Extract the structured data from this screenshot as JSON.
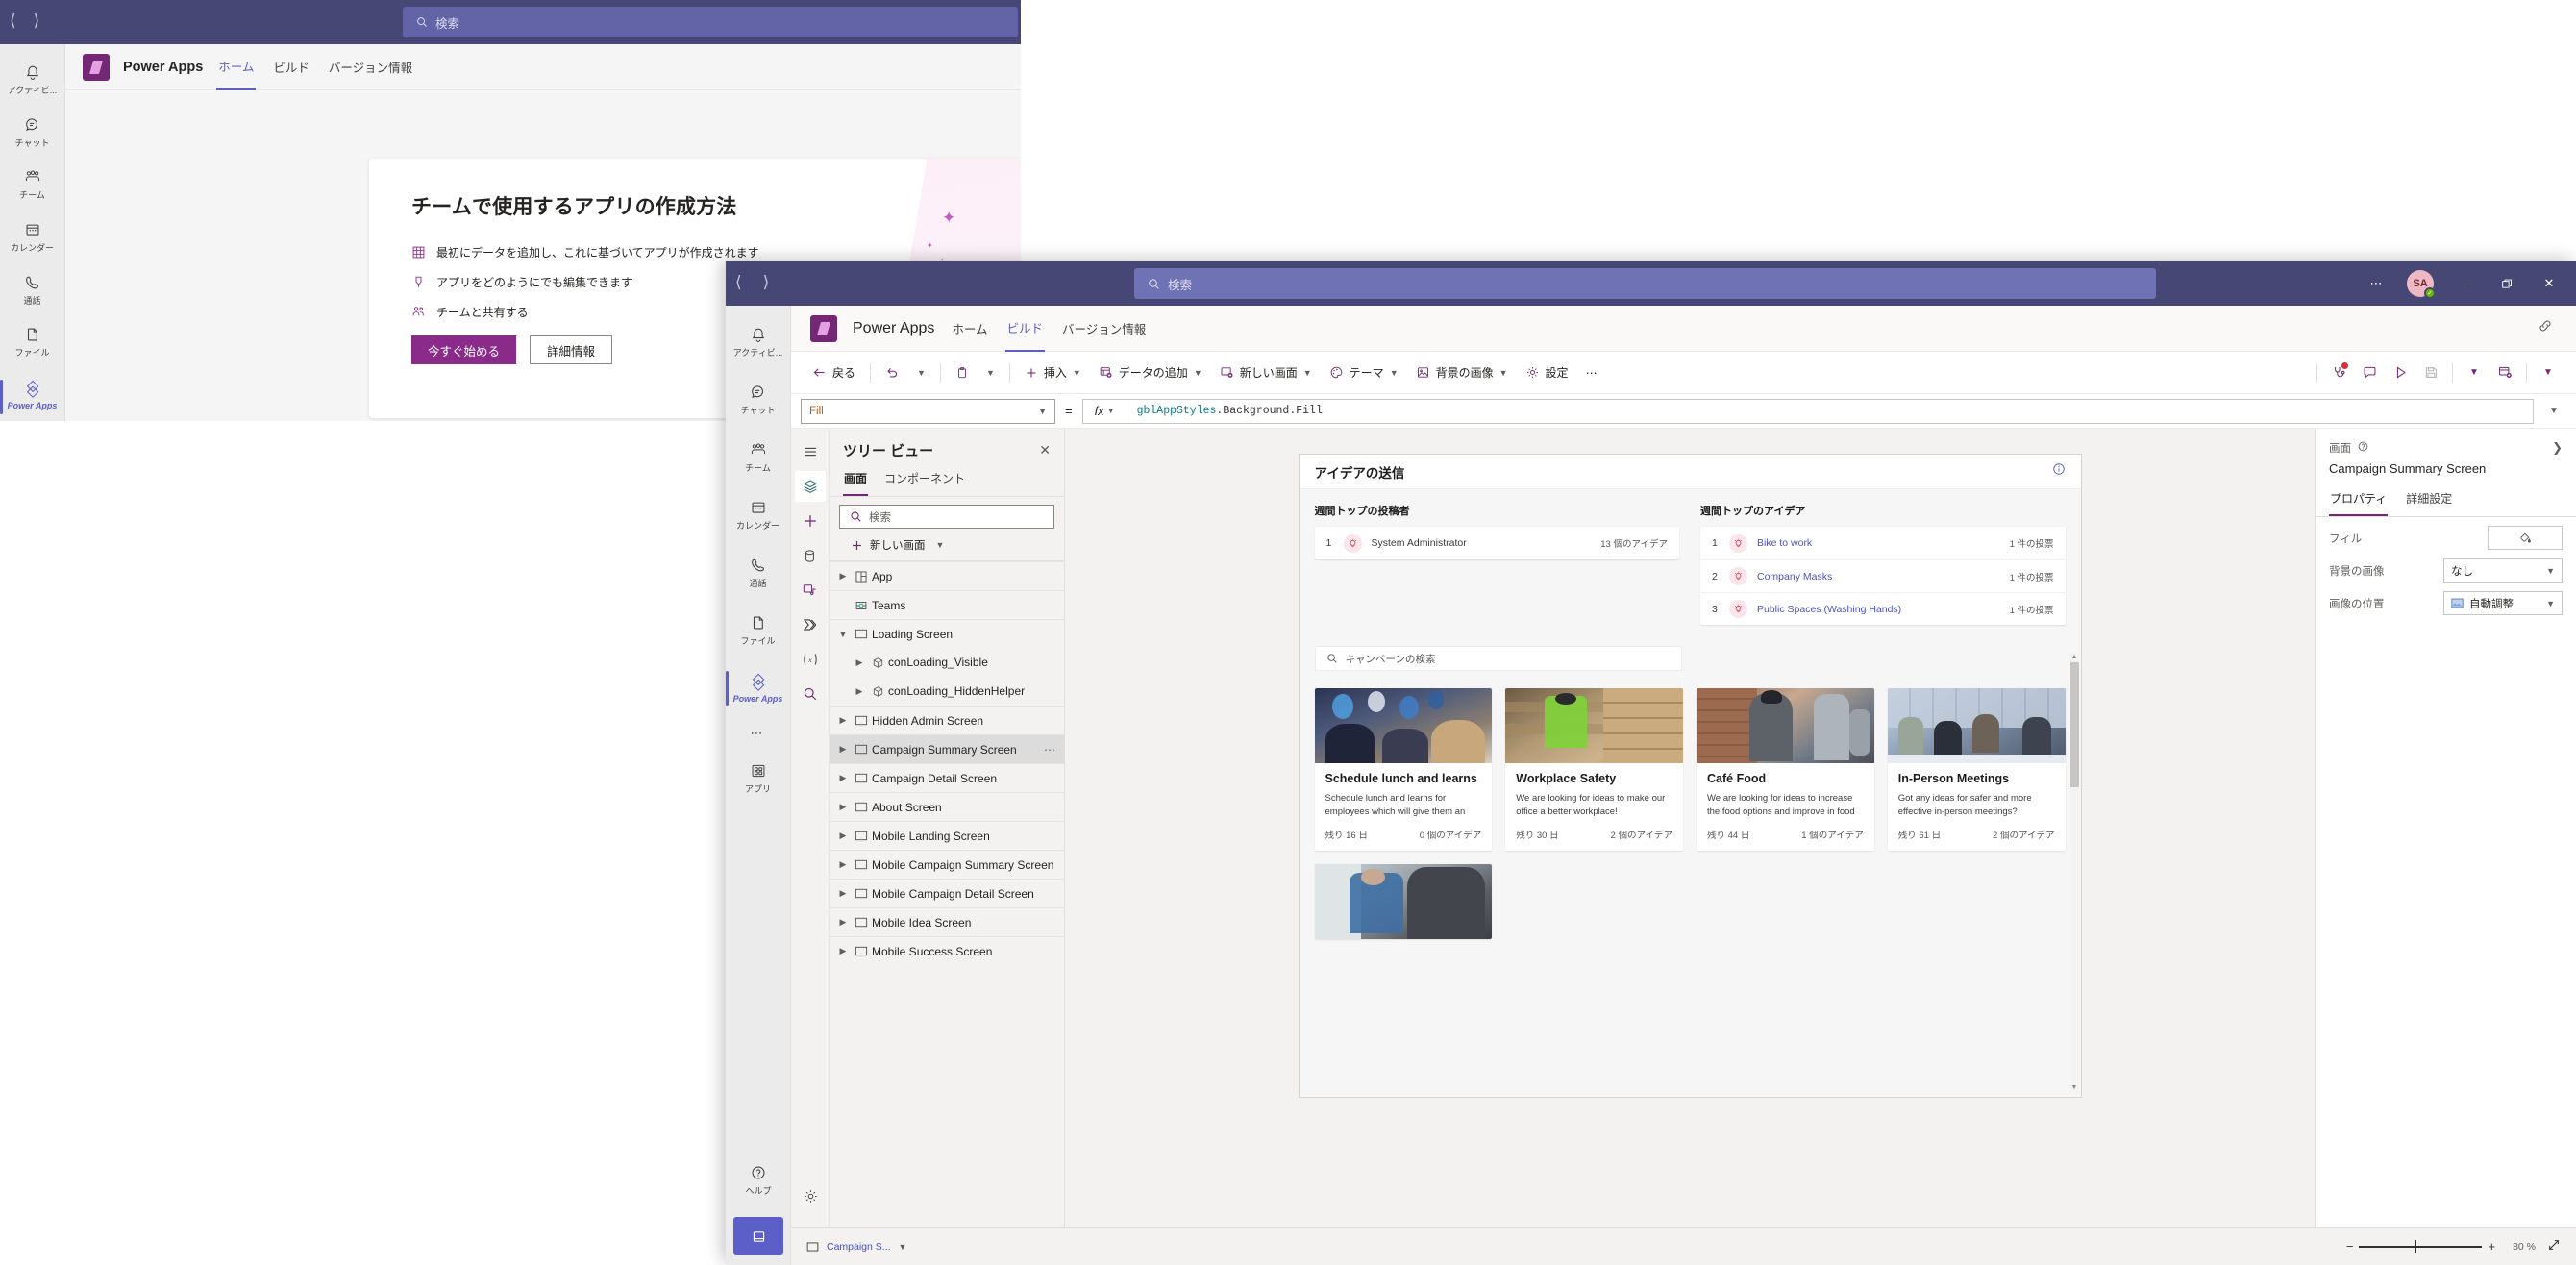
{
  "background_window": {
    "titlebar": {
      "back_icon": "chevron-left-icon",
      "forward_icon": "chevron-right-icon"
    },
    "search": {
      "placeholder": "検索",
      "icon": "search-icon"
    },
    "rail": [
      {
        "label": "アクティビ...",
        "icon": "bell-icon",
        "active": false
      },
      {
        "label": "チャット",
        "icon": "chat-icon",
        "active": false
      },
      {
        "label": "チーム",
        "icon": "teams-icon",
        "active": false
      },
      {
        "label": "カレンダー",
        "icon": "calendar-icon",
        "active": false
      },
      {
        "label": "通話",
        "icon": "phone-icon",
        "active": false
      },
      {
        "label": "ファイル",
        "icon": "file-icon",
        "active": false
      },
      {
        "label": "Power Apps",
        "icon": "power-apps-icon",
        "active": true
      }
    ],
    "app_header": {
      "app_name": "Power Apps",
      "logo_icon": "power-apps-logo",
      "tabs": [
        {
          "label": "ホーム",
          "selected": true
        },
        {
          "label": "ビルド",
          "selected": false
        },
        {
          "label": "バージョン情報",
          "selected": false
        }
      ]
    },
    "promo_card": {
      "title": "チームで使用するアプリの作成方法",
      "bullets": [
        {
          "icon": "table-icon",
          "text": "最初にデータを追加し、これに基づいてアプリが作成されます"
        },
        {
          "icon": "edit-pen-icon",
          "text": "アプリをどのようにでも編集できます"
        },
        {
          "icon": "share-people-icon",
          "text": "チームと共有する"
        }
      ],
      "primary_button": "今すぐ始める",
      "secondary_button": "詳細情報"
    }
  },
  "studio_window": {
    "titlebar": {
      "back_icon": "chevron-left-icon",
      "forward_icon": "chevron-right-icon",
      "search": {
        "placeholder": "検索",
        "icon": "search-icon"
      },
      "more_icon": "ellipsis-icon",
      "avatar_initials": "SA",
      "presence": "available",
      "minimize_icon": "minimize-icon",
      "restore_icon": "restore-icon",
      "close_icon": "close-icon"
    },
    "rail": [
      {
        "label": "アクティビ...",
        "icon": "bell-icon",
        "active": false
      },
      {
        "label": "チャット",
        "icon": "chat-icon",
        "active": false
      },
      {
        "label": "チーム",
        "icon": "teams-icon",
        "active": false
      },
      {
        "label": "カレンダー",
        "icon": "calendar-icon",
        "active": false
      },
      {
        "label": "通話",
        "icon": "phone-icon",
        "active": false
      },
      {
        "label": "ファイル",
        "icon": "file-icon",
        "active": false
      },
      {
        "label": "Power Apps",
        "icon": "power-apps-icon",
        "active": true
      },
      {
        "label": "",
        "icon": "ellipsis-icon",
        "active": false
      },
      {
        "label": "アプリ",
        "icon": "apps-grid-icon",
        "active": false
      }
    ],
    "rail_bottom": [
      {
        "label": "ヘルプ",
        "icon": "help-circle-icon"
      }
    ],
    "rail_chat_button_icon": "new-chat-icon",
    "app_header": {
      "app_name": "Power Apps",
      "logo_icon": "power-apps-logo",
      "tabs": [
        {
          "label": "ホーム",
          "selected": false
        },
        {
          "label": "ビルド",
          "selected": true
        },
        {
          "label": "バージョン情報",
          "selected": false
        }
      ],
      "right_icon": "link-chain-icon"
    },
    "command_bar": {
      "items": [
        {
          "label": "戻る",
          "icon": "arrow-left-icon",
          "caret": false
        },
        {
          "label": "",
          "icon": "undo-icon",
          "caret": true
        },
        {
          "label": "",
          "icon": "clipboard-icon",
          "caret": true
        },
        {
          "label": "挿入",
          "icon": "plus-icon",
          "caret": true
        },
        {
          "label": "データの追加",
          "icon": "database-add-icon",
          "caret": true
        },
        {
          "label": "新しい画面",
          "icon": "screen-add-icon",
          "caret": true
        },
        {
          "label": "テーマ",
          "icon": "palette-icon",
          "caret": true
        },
        {
          "label": "背景の画像",
          "icon": "image-icon",
          "caret": true
        },
        {
          "label": "設定",
          "icon": "gear-icon",
          "caret": false
        },
        {
          "label": "…",
          "icon": "ellipsis-icon",
          "caret": false
        }
      ],
      "right_items": [
        {
          "icon": "app-checker-icon",
          "badge": true
        },
        {
          "icon": "comment-icon",
          "badge": false
        },
        {
          "icon": "play-preview-icon",
          "badge": false
        },
        {
          "icon": "save-icon",
          "badge": false,
          "disabled": true
        },
        {
          "icon": "chevron-down-icon",
          "badge": false
        },
        {
          "icon": "publish-icon",
          "badge": false
        },
        {
          "icon": "chevron-down-icon",
          "badge": false
        }
      ]
    },
    "formula_bar": {
      "property": "Fill",
      "equals": "=",
      "fx_label": "fx",
      "formula_token": "gblAppStyles",
      "formula_rest": ".Background.Fill",
      "expand_icon": "chevron-down-icon"
    },
    "icon_strip": [
      {
        "icon": "hamburger-menu-icon",
        "selected": false
      },
      {
        "icon": "tree-view-layers-icon",
        "selected": true
      },
      {
        "icon": "insert-plus-icon",
        "selected": false
      },
      {
        "icon": "data-cylinder-icon",
        "selected": false
      },
      {
        "icon": "media-icon",
        "selected": false
      },
      {
        "icon": "power-automate-icon",
        "selected": false
      },
      {
        "icon": "variables-icon",
        "selected": false
      },
      {
        "icon": "search-icon",
        "selected": false
      }
    ],
    "icon_strip_bottom": [
      {
        "icon": "gear-icon"
      },
      {
        "icon": "copilot-robot-icon"
      }
    ],
    "tree_view": {
      "title": "ツリー ビュー",
      "close_icon": "close-icon",
      "tabs": [
        {
          "label": "画面",
          "selected": true
        },
        {
          "label": "コンポーネント",
          "selected": false
        }
      ],
      "search_placeholder": "検索",
      "search_icon": "search-icon",
      "new_screen_label": "新しい画面",
      "new_screen_icon": "plus-icon",
      "nodes": [
        {
          "label": "App",
          "icon": "app-icon",
          "indent": 0,
          "chevron": "collapsed",
          "selected": false,
          "divider": true
        },
        {
          "label": "Teams",
          "icon": "teams-component-icon",
          "indent": 0,
          "chevron": "none",
          "selected": false,
          "divider": true
        },
        {
          "label": "Loading Screen",
          "icon": "screen-icon",
          "indent": 0,
          "chevron": "expanded",
          "selected": false,
          "divider": true
        },
        {
          "label": "conLoading_Visible",
          "icon": "container-icon",
          "indent": 1,
          "chevron": "collapsed",
          "selected": false,
          "divider": false
        },
        {
          "label": "conLoading_HiddenHelper",
          "icon": "container-icon",
          "indent": 1,
          "chevron": "collapsed",
          "selected": false,
          "divider": false
        },
        {
          "label": "Hidden Admin Screen",
          "icon": "screen-icon",
          "indent": 0,
          "chevron": "collapsed",
          "selected": false,
          "divider": true
        },
        {
          "label": "Campaign Summary Screen",
          "icon": "screen-icon",
          "indent": 0,
          "chevron": "collapsed",
          "selected": true,
          "divider": true,
          "more_icon": "ellipsis-icon"
        },
        {
          "label": "Campaign Detail Screen",
          "icon": "screen-icon",
          "indent": 0,
          "chevron": "collapsed",
          "selected": false,
          "divider": true
        },
        {
          "label": "About Screen",
          "icon": "screen-icon",
          "indent": 0,
          "chevron": "collapsed",
          "selected": false,
          "divider": true
        },
        {
          "label": "Mobile Landing Screen",
          "icon": "screen-icon",
          "indent": 0,
          "chevron": "collapsed",
          "selected": false,
          "divider": true
        },
        {
          "label": "Mobile Campaign Summary Screen",
          "icon": "screen-icon",
          "indent": 0,
          "chevron": "collapsed",
          "selected": false,
          "divider": true
        },
        {
          "label": "Mobile Campaign Detail Screen",
          "icon": "screen-icon",
          "indent": 0,
          "chevron": "collapsed",
          "selected": false,
          "divider": true
        },
        {
          "label": "Mobile Idea Screen",
          "icon": "screen-icon",
          "indent": 0,
          "chevron": "collapsed",
          "selected": false,
          "divider": true
        },
        {
          "label": "Mobile Success Screen",
          "icon": "screen-icon",
          "indent": 0,
          "chevron": "collapsed",
          "selected": false,
          "divider": true
        }
      ]
    },
    "canvas": {
      "screen_title": "アイデアの送信",
      "info_icon": "info-circle-icon",
      "top_contributors": {
        "heading": "週間トップの投稿者",
        "rows": [
          {
            "rank": "1",
            "name": "System Administrator",
            "meta": "13 個のアイデア",
            "icon": "lightbulb-icon"
          }
        ]
      },
      "top_ideas": {
        "heading": "週間トップのアイデア",
        "rows": [
          {
            "rank": "1",
            "name": "Bike to work",
            "meta": "1 件の投票",
            "icon": "lightbulb-icon"
          },
          {
            "rank": "2",
            "name": "Company Masks",
            "meta": "1 件の投票",
            "icon": "lightbulb-icon"
          },
          {
            "rank": "3",
            "name": "Public Spaces (Washing Hands)",
            "meta": "1 件の投票",
            "icon": "lightbulb-icon"
          }
        ]
      },
      "campaign_search_placeholder": "キャンペーンの検索",
      "campaign_search_icon": "search-icon",
      "campaign_cards": [
        {
          "title": "Schedule lunch and learns",
          "description": "Schedule lunch and learns for employees which will give them an incentive to come",
          "days_left": "残り 16 日",
          "ideas": "0 個のアイデア",
          "image": "office-party-balloons"
        },
        {
          "title": "Workplace Safety",
          "description": "We are looking for ideas to make our office a better workplace!",
          "days_left": "残り 30 日",
          "ideas": "2 個のアイデア",
          "image": "warehouse-worker-boxes"
        },
        {
          "title": "Café Food",
          "description": "We are looking for ideas to increase the food options and improve in food quality.",
          "days_left": "残り 44 日",
          "ideas": "1 個のアイデア",
          "image": "cafe-kitchen-staff"
        },
        {
          "title": "In-Person Meetings",
          "description": "Got any ideas for safer and more effective in-person meetings?",
          "days_left": "残り 61 日",
          "ideas": "2 個のアイデア",
          "image": "conference-room-meeting"
        },
        {
          "title": "",
          "description": "",
          "days_left": "",
          "ideas": "",
          "image": "bus-driver-mask"
        }
      ]
    },
    "properties_panel": {
      "kind_label": "画面",
      "help_icon": "question-circle-icon",
      "expand_icon": "chevron-right-icon",
      "selected_name": "Campaign Summary Screen",
      "tabs": [
        {
          "label": "プロパティ",
          "selected": true
        },
        {
          "label": "詳細設定",
          "selected": false
        }
      ],
      "rows": [
        {
          "label": "フィル",
          "control": "color-swatch",
          "value": "",
          "icon": "paint-bucket-icon"
        },
        {
          "label": "背景の画像",
          "control": "dropdown",
          "value": "なし",
          "icon": ""
        },
        {
          "label": "画像の位置",
          "control": "dropdown",
          "value": "自動調整",
          "icon": "image-thumb-icon"
        }
      ]
    },
    "status_bar": {
      "screen_name": "Campaign S...",
      "screen_icon": "screen-icon",
      "caret_icon": "chevron-down-icon",
      "zoom_minus": "−",
      "zoom_plus": "+",
      "zoom_value": "80 %",
      "fit_icon": "fit-screen-icon"
    }
  },
  "colors": {
    "teams_purple": "#464775",
    "teams_accent": "#5b5fc7",
    "power_apps_purple": "#742774",
    "selection_gray": "#dcdcdc",
    "canvas_bg": "#f3f2f1"
  }
}
